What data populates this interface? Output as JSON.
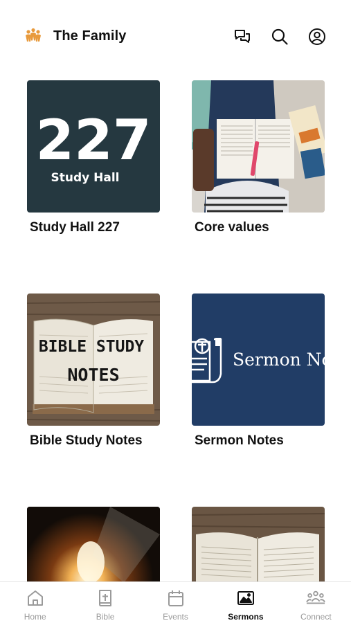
{
  "header": {
    "title": "The Family",
    "logo_icon": "family-people-icon",
    "icons": [
      "chat-icon",
      "search-icon",
      "profile-icon"
    ]
  },
  "cards": [
    {
      "title": "Study Hall 227",
      "thumb_big_text": "227",
      "thumb_small_text": "Study Hall"
    },
    {
      "title": "Core values"
    },
    {
      "title": "Bible Study Notes",
      "thumb_line1": "BIBLE STUDY",
      "thumb_line2": "NOTES"
    },
    {
      "title": "Sermon Notes",
      "thumb_text": "Sermon No"
    },
    {
      "title": ""
    },
    {
      "title": ""
    }
  ],
  "tabs": [
    {
      "label": "Home",
      "icon": "home-icon",
      "active": false
    },
    {
      "label": "Bible",
      "icon": "bible-icon",
      "active": false
    },
    {
      "label": "Events",
      "icon": "calendar-icon",
      "active": false
    },
    {
      "label": "Sermons",
      "icon": "image-icon",
      "active": true
    },
    {
      "label": "Connect",
      "icon": "group-icon",
      "active": false
    }
  ],
  "colors": {
    "accent": "#e89a3c",
    "study_hall_bg": "#253840",
    "sermon_bg": "#213d66",
    "active_tab": "#111111",
    "inactive_tab": "#9a9a9a"
  }
}
